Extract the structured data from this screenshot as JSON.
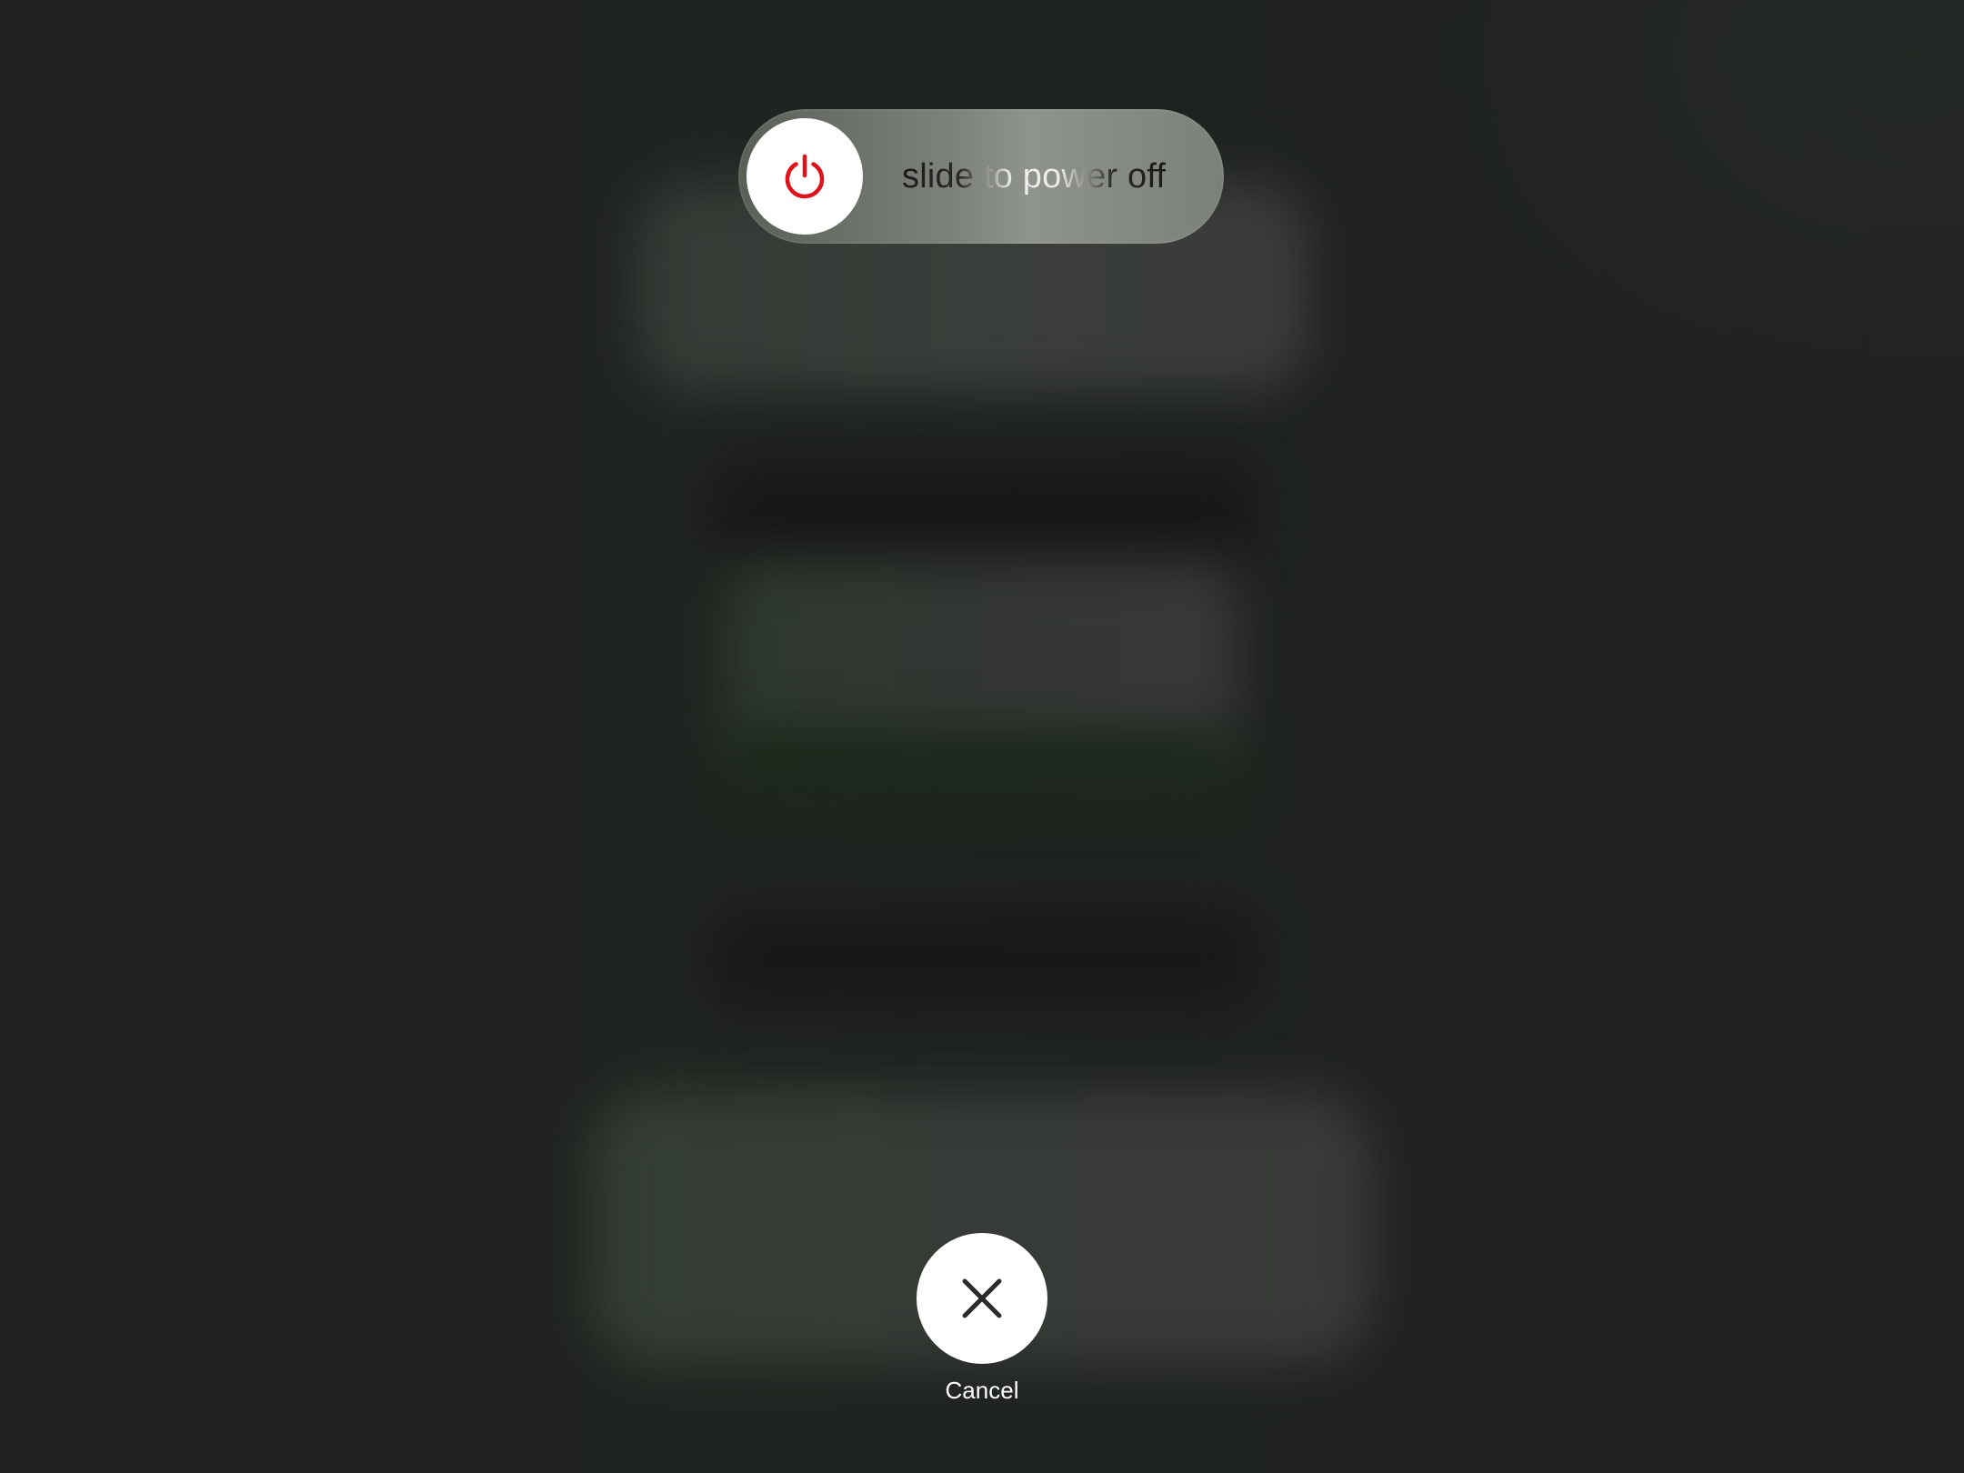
{
  "power_slider": {
    "label": "slide to power off",
    "icon": "power-icon",
    "icon_color": "#e0121a"
  },
  "cancel": {
    "label": "Cancel",
    "icon": "close-icon",
    "icon_color": "#2b2b2b"
  }
}
